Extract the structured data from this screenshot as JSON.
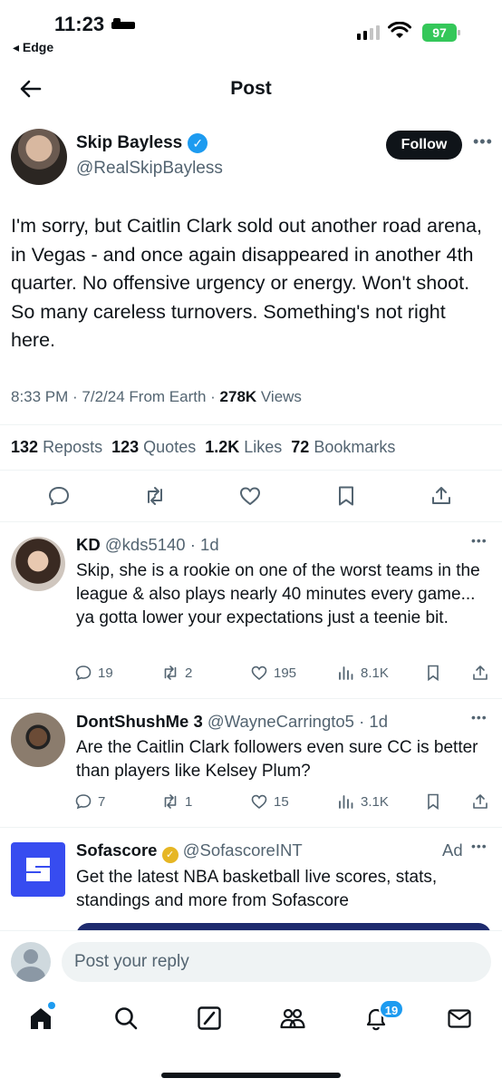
{
  "status_bar": {
    "time": "11:23",
    "back_app": "◂ Edge",
    "battery": "97"
  },
  "header": {
    "title": "Post"
  },
  "tweet": {
    "author_name": "Skip Bayless",
    "author_handle": "@RealSkipBayless",
    "follow_label": "Follow",
    "text": "I'm sorry, but Caitlin Clark sold out another road arena, in Vegas - and once again disappeared in another 4th quarter. No offensive urgency or energy. Won't shoot. So many careless turnovers. Something's not right here.",
    "meta": {
      "time_date": "8:33 PM · 7/2/24 From Earth · ",
      "views_count": "278K",
      "views_label": " Views"
    },
    "stats": [
      {
        "count": "132",
        "label": "Reposts"
      },
      {
        "count": "123",
        "label": "Quotes"
      },
      {
        "count": "1.2K",
        "label": "Likes"
      },
      {
        "count": "72",
        "label": "Bookmarks"
      }
    ]
  },
  "replies": [
    {
      "name": "KD",
      "handle_time": "@kds5140 · 1d",
      "text": "Skip, she is a rookie on one of the worst teams in the league & also plays nearly 40 minutes every game... ya gotta lower your expectations just a teenie bit.",
      "replies": "19",
      "reposts": "2",
      "likes": "195",
      "views": "8.1K"
    },
    {
      "name": "DontShushMe 3",
      "handle_time": "@WayneCarringto5 · 1d",
      "text": "Are the Caitlin Clark followers even sure CC is better than players  like Kelsey Plum?",
      "replies": "7",
      "reposts": "1",
      "likes": "15",
      "views": "3.1K"
    }
  ],
  "ad": {
    "name": "Sofascore",
    "handle": "@SofascoreINT",
    "ad_label": "Ad",
    "text": "Get the latest NBA basketball live scores, stats, standings and more from Sofascore"
  },
  "composer": {
    "placeholder": "Post your reply"
  },
  "nav": {
    "notifications_badge": "19"
  },
  "colors": {
    "accent": "#1d9bf0",
    "secondary_text": "#536471",
    "ad_brand": "#374cf0",
    "verified_gold": "#e6b624"
  }
}
